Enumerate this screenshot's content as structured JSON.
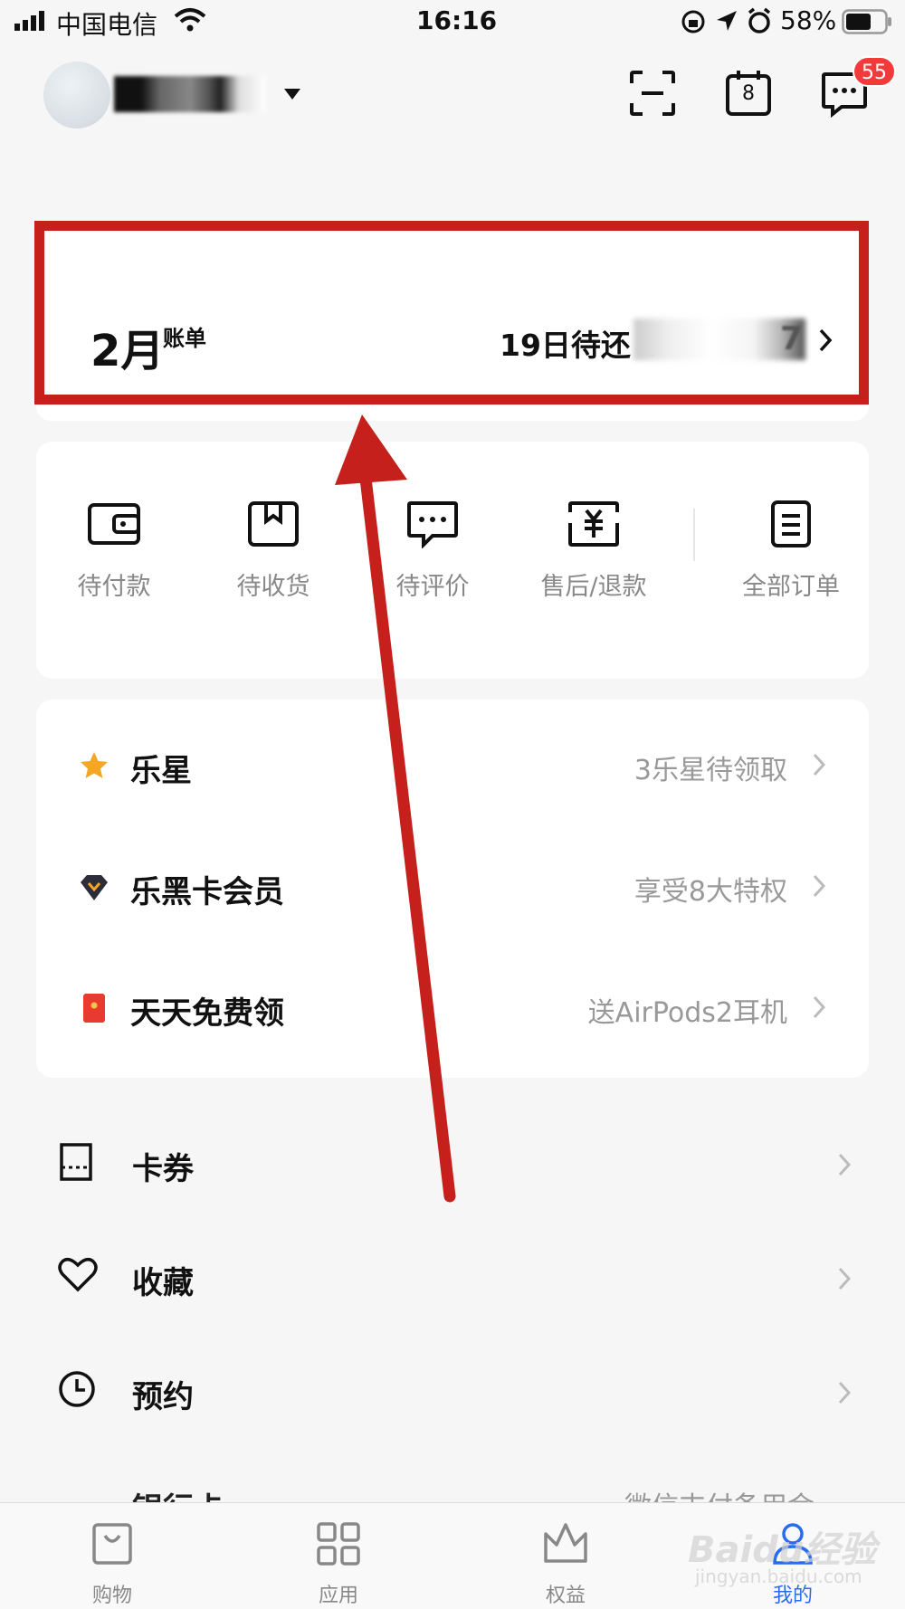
{
  "status_bar": {
    "carrier": "中国电信",
    "time": "16:16",
    "battery": "58%"
  },
  "header": {
    "message_badge": "55",
    "calendar_day": "8"
  },
  "bill": {
    "month": "2月",
    "label": "账单",
    "due": "19日待还 ¥",
    "amount_tail": "7"
  },
  "orders": [
    {
      "label": "待付款",
      "icon": "wallet-icon"
    },
    {
      "label": "待收货",
      "icon": "package-icon"
    },
    {
      "label": "待评价",
      "icon": "comment-icon"
    },
    {
      "label": "售后/退款",
      "icon": "refund-icon"
    },
    {
      "label": "全部订单",
      "icon": "order-list-icon"
    }
  ],
  "perks": [
    {
      "title": "乐星",
      "sub": "3乐星待领取",
      "icon": "star-icon"
    },
    {
      "title": "乐黑卡会员",
      "sub": "享受8大特权",
      "icon": "diamond-icon"
    },
    {
      "title": "天天免费领",
      "sub": "送AirPods2耳机",
      "icon": "red-packet-icon"
    }
  ],
  "list": [
    {
      "label": "卡券",
      "icon": "coupon-icon"
    },
    {
      "label": "收藏",
      "icon": "heart-icon"
    },
    {
      "label": "预约",
      "icon": "clock-icon"
    }
  ],
  "partial_row": {
    "label": "银行卡",
    "sub": "微信支付备用金"
  },
  "tabs": [
    {
      "label": "购物",
      "icon": "shopping-bag-icon"
    },
    {
      "label": "应用",
      "icon": "apps-grid-icon"
    },
    {
      "label": "权益",
      "icon": "crown-icon"
    },
    {
      "label": "我的",
      "icon": "profile-icon"
    }
  ],
  "watermark": {
    "text": "Baidu经验",
    "sub": "jingyan.baidu.com"
  },
  "colors": {
    "highlight": "#c5201b",
    "active_tab": "#2a6cf0",
    "badge": "#f33a3a",
    "star": "#f5a623"
  }
}
